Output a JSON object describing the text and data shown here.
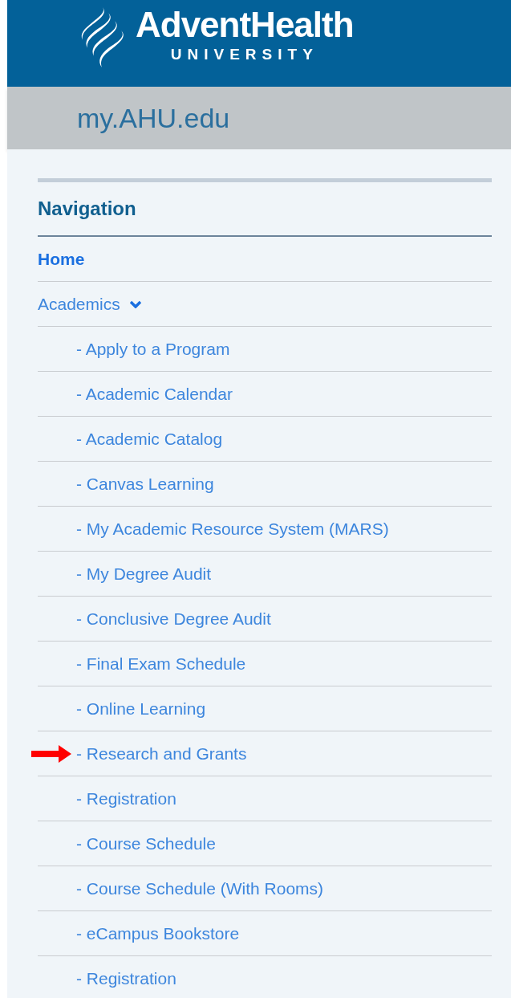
{
  "header": {
    "brand": "AdventHealth",
    "subtitle": "UNIVERSITY"
  },
  "site_title": "my.AHU.edu",
  "navigation": {
    "title": "Navigation",
    "items": [
      {
        "label": "Home",
        "selected": true
      },
      {
        "label": "Academics",
        "selected": false,
        "expanded": true,
        "children": [
          {
            "label": "- Apply to a Program",
            "arrow": false
          },
          {
            "label": "- Academic Calendar",
            "arrow": false
          },
          {
            "label": "- Academic Catalog",
            "arrow": false
          },
          {
            "label": "- Canvas Learning",
            "arrow": false
          },
          {
            "label": "- My Academic Resource System (MARS)",
            "arrow": false
          },
          {
            "label": "- My Degree Audit",
            "arrow": false
          },
          {
            "label": "- Conclusive Degree Audit",
            "arrow": false
          },
          {
            "label": "- Final Exam Schedule",
            "arrow": false
          },
          {
            "label": "- Online Learning",
            "arrow": false
          },
          {
            "label": "- Research and Grants",
            "arrow": true
          },
          {
            "label": "- Registration",
            "arrow": false
          },
          {
            "label": "- Course Schedule",
            "arrow": false
          },
          {
            "label": "- Course Schedule (With Rooms)",
            "arrow": false
          },
          {
            "label": "- eCampus Bookstore",
            "arrow": false
          },
          {
            "label": "- Registration",
            "arrow": false
          }
        ]
      }
    ]
  }
}
